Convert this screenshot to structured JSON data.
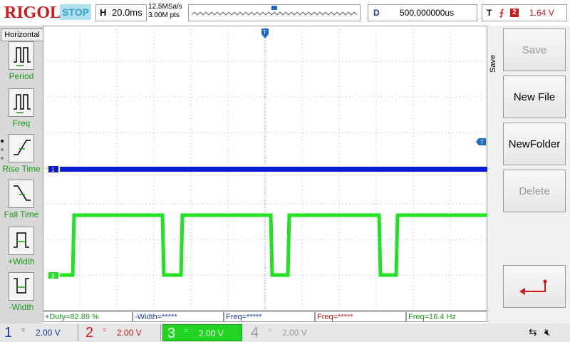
{
  "header": {
    "brand": "RIGOL",
    "run_state": "STOP",
    "horizontal_key": "H",
    "timebase": "20.0ms",
    "sample_rate": "12.5MSa/s",
    "memory_depth": "3.00M pts",
    "delay_key": "D",
    "delay_value": "500.000000us",
    "trigger_key": "T",
    "trigger_source": "2",
    "trigger_level": "1.64 V",
    "trigger_marker": "T"
  },
  "left_panel": {
    "title": "Horizontal",
    "items": [
      {
        "label": "Period"
      },
      {
        "label": "Freq"
      },
      {
        "label": "Rise Time"
      },
      {
        "label": "Fall Time"
      },
      {
        "label": "+Width"
      },
      {
        "label": "-Width"
      }
    ]
  },
  "right_panel": {
    "section": "Save",
    "buttons": [
      {
        "label": "Save",
        "enabled": false
      },
      {
        "label": "New File",
        "enabled": true
      },
      {
        "label": "NewFolder",
        "enabled": true
      },
      {
        "label": "Delete",
        "enabled": false
      }
    ],
    "back_icon": "return-arrow-icon"
  },
  "measurements": [
    {
      "text": "+Duty=82.89 %",
      "color": "#1a9a1a"
    },
    {
      "text": "-Width=*****",
      "color": "#1a3aa0"
    },
    {
      "text": "Freq=*****",
      "color": "#1a3aa0"
    },
    {
      "text": "Freq=*****",
      "color": "#c01818"
    },
    {
      "text": "Freq=16.4 Hz",
      "color": "#1a9a1a"
    }
  ],
  "channels": [
    {
      "num": "1",
      "coupling": "=",
      "scale": "2.00 V",
      "color": "#1a3aa0",
      "active": false
    },
    {
      "num": "2",
      "coupling": "=",
      "scale": "2.00 V",
      "color": "#d01818",
      "active": false
    },
    {
      "num": "3",
      "coupling": "=",
      "scale": "2.00 V",
      "color": "#1aa01a",
      "active": true
    },
    {
      "num": "4",
      "coupling": "=",
      "scale": "2.00 V",
      "color": "#9a9a9a",
      "active": false
    }
  ],
  "markers": {
    "ch1": "1",
    "ch3": "3"
  },
  "colors": {
    "ch1": "#0a1ad0",
    "ch3": "#22e022",
    "trigger": "#1a6ad0",
    "brand": "#d01818",
    "accent": "#1a9a1a"
  },
  "status_icons": [
    "usb-icon",
    "speaker-mute-icon"
  ]
}
